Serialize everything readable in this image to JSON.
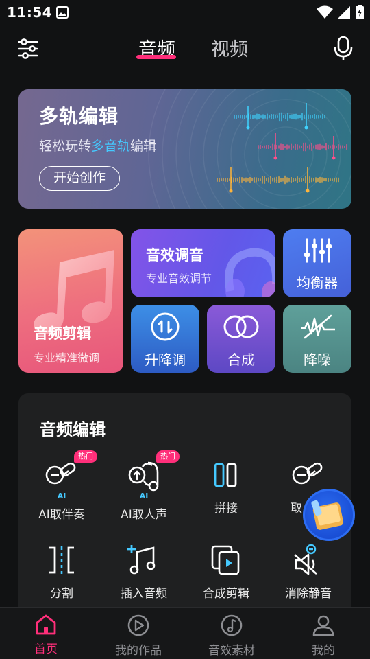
{
  "status_bar": {
    "time": "11:54"
  },
  "header": {
    "tabs": [
      {
        "label": "音频",
        "active": true
      },
      {
        "label": "视频",
        "active": false
      }
    ]
  },
  "banner": {
    "title": "多轨编辑",
    "subtitle_prefix": "轻松玩转",
    "subtitle_highlight": "多音轨",
    "subtitle_suffix": "编辑",
    "button": "开始创作"
  },
  "features": {
    "audio_edit": {
      "title": "音频剪辑",
      "subtitle": "专业精准微调"
    },
    "sound_fx": {
      "title": "音效调音",
      "subtitle": "专业音效调节"
    },
    "equalizer": {
      "title": "均衡器"
    },
    "pitch": {
      "title": "升降调"
    },
    "mix": {
      "title": "合成"
    },
    "denoise": {
      "title": "降噪"
    }
  },
  "tools_panel": {
    "title": "音频编辑",
    "hot_badge": "热门",
    "ai_badge": "AI",
    "tools": [
      {
        "label": "AI取伴奏",
        "icon": "ai-accompaniment-icon",
        "hot": true
      },
      {
        "label": "AI取人声",
        "icon": "ai-vocal-icon",
        "hot": true
      },
      {
        "label": "拼接",
        "icon": "splice-icon"
      },
      {
        "label": "取",
        "icon": "extract-icon"
      },
      {
        "label": "分割",
        "icon": "split-icon"
      },
      {
        "label": "插入音频",
        "icon": "insert-audio-icon"
      },
      {
        "label": "合成剪辑",
        "icon": "merge-clip-icon"
      },
      {
        "label": "消除静音",
        "icon": "remove-silence-icon"
      }
    ]
  },
  "bottom_nav": [
    {
      "label": "首页",
      "icon": "home-icon",
      "active": true
    },
    {
      "label": "我的作品",
      "icon": "my-works-icon"
    },
    {
      "label": "音效素材",
      "icon": "sound-material-icon"
    },
    {
      "label": "我的",
      "icon": "profile-icon"
    }
  ],
  "colors": {
    "accent": "#ff2f7a",
    "highlight": "#45c9ff",
    "panel": "#1f2021",
    "background": "#111213"
  }
}
